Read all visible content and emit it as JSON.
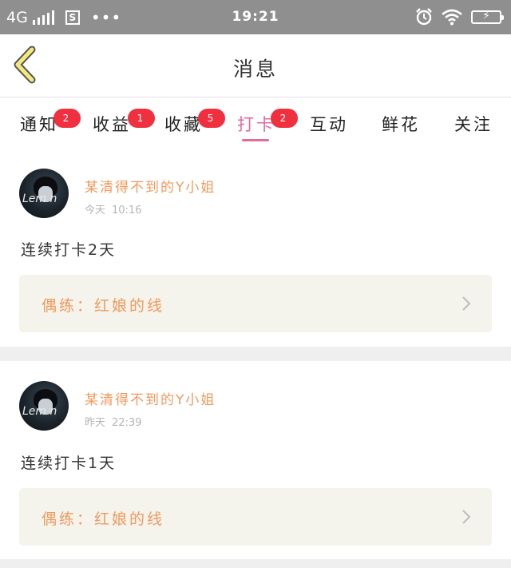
{
  "status_bar": {
    "network": "4G",
    "sim_label": "S",
    "more": "•••",
    "time": "19:21",
    "battery_icon": "battery-charging-icon",
    "wifi_icon": "wifi-icon",
    "alarm_icon": "alarm-clock-icon"
  },
  "header": {
    "title": "消息",
    "back_icon": "chevron-left-icon"
  },
  "tabs": [
    {
      "label": "通知",
      "badge": "2"
    },
    {
      "label": "收益",
      "badge": "1"
    },
    {
      "label": "收藏",
      "badge": "5"
    },
    {
      "label": "打卡",
      "badge": "2",
      "active": true
    },
    {
      "label": "互动",
      "badge": ""
    },
    {
      "label": "鲜花",
      "badge": ""
    },
    {
      "label": "关注",
      "badge": ""
    }
  ],
  "posts": [
    {
      "username": "某清得不到的Y小姐",
      "day": "今天",
      "time": "10:16",
      "message": "连续打卡2天",
      "link_label": "偶练：",
      "link_title": "红娘的线",
      "avatar_text": "Lem n"
    },
    {
      "username": "某清得不到的Y小姐",
      "day": "昨天",
      "time": "22:39",
      "message": "连续打卡1天",
      "link_label": "偶练：",
      "link_title": "红娘的线",
      "avatar_text": "Lem n"
    }
  ],
  "colors": {
    "accent_pink": "#e16aa0",
    "username_orange": "#f09a5d",
    "badge_red": "#f0303f",
    "back_icon_yellow": "#f5e97a"
  }
}
